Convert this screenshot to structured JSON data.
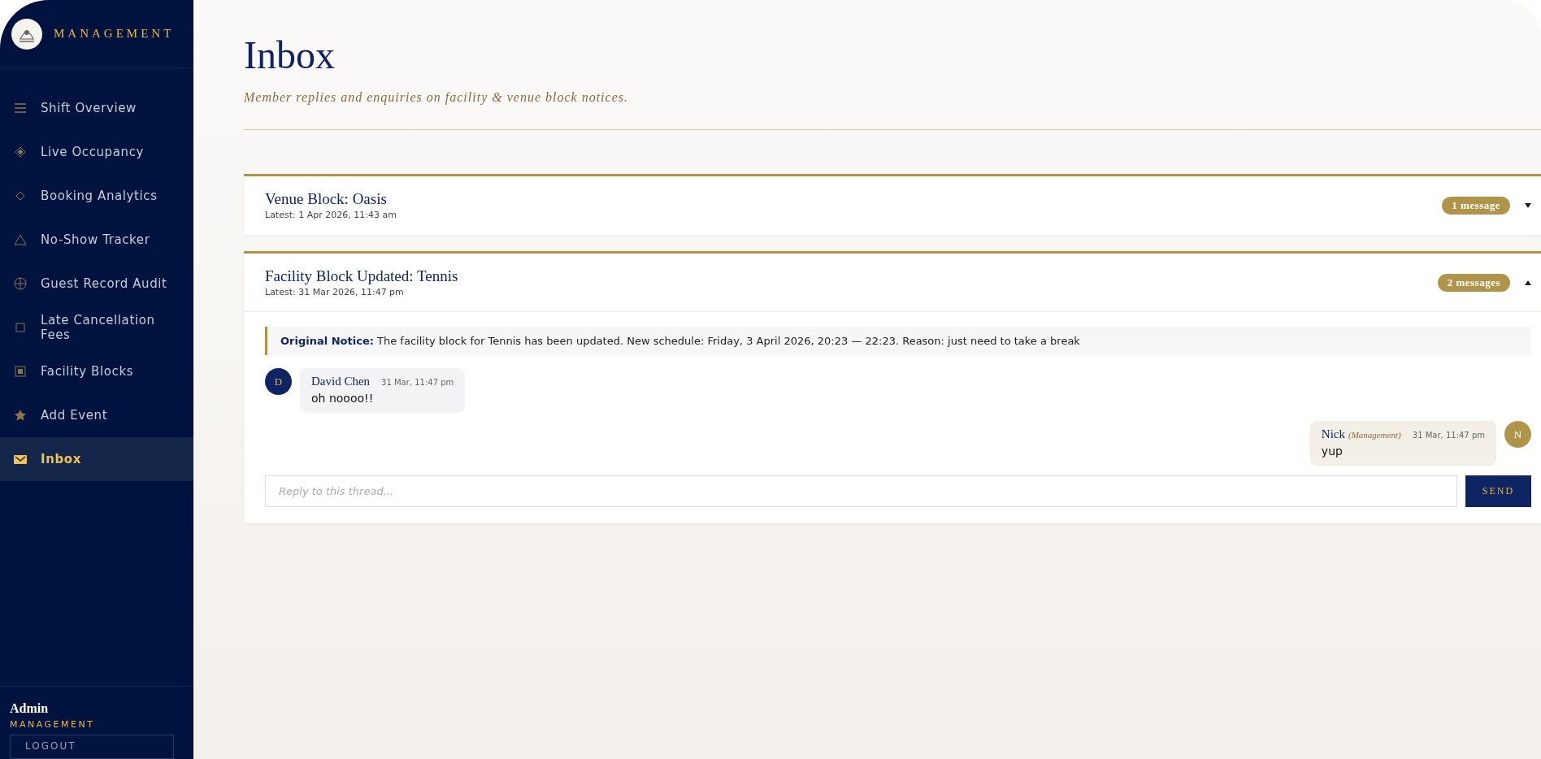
{
  "sidebar": {
    "brand": "MANAGEMENT",
    "items": [
      {
        "label": "Shift Overview",
        "selected": false
      },
      {
        "label": "Live Occupancy",
        "selected": false
      },
      {
        "label": "Booking Analytics",
        "selected": false
      },
      {
        "label": "No-Show Tracker",
        "selected": false
      },
      {
        "label": "Guest Record Audit",
        "selected": false
      },
      {
        "label": "Late Cancellation Fees",
        "selected": false
      },
      {
        "label": "Facility Blocks",
        "selected": false
      },
      {
        "label": "Add Event",
        "selected": false
      },
      {
        "label": "Inbox",
        "selected": true
      }
    ],
    "user": {
      "name": "Admin",
      "role": "MANAGEMENT",
      "logout": "LOGOUT"
    }
  },
  "header": {
    "title": "Inbox",
    "subtitle": "Member replies and enquiries on facility & venue block notices."
  },
  "threads": [
    {
      "title": "Venue Block: Oasis",
      "latest": "Latest: 1 Apr 2026, 11:43 am",
      "count": "1 message",
      "expanded": false
    },
    {
      "title": "Facility Block Updated: Tennis",
      "latest": "Latest: 31 Mar 2026, 11:47 pm",
      "count": "2 messages",
      "expanded": true,
      "notice": "**Original Notice:** The facility block for Tennis has been updated. New schedule: Friday, 3 April 2026, 20:23 — 22:23. Reason: just need to take a break",
      "messages": [
        {
          "kind": "incoming",
          "initial": "D",
          "author": "David Chen",
          "time": "31 Mar, 11:47 pm",
          "text": "oh noooo!!"
        },
        {
          "kind": "outgoing",
          "initial": "N",
          "author": "Nick",
          "role": "(Management)",
          "time": "31 Mar, 11:47 pm",
          "text": "yup"
        }
      ],
      "reply": {
        "placeholder": "Reply to this thread...",
        "button": "SEND"
      }
    }
  ]
}
